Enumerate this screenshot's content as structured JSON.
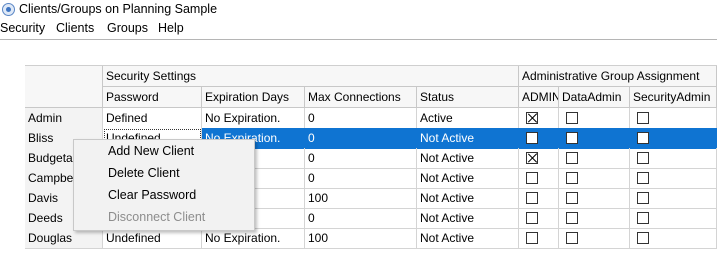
{
  "window": {
    "title": "Clients/Groups on Planning Sample"
  },
  "menu": {
    "items": [
      "Security",
      "Clients",
      "Groups",
      "Help"
    ]
  },
  "grid": {
    "group_headers": {
      "security": "Security Settings",
      "admin": "Administrative Group Assignment"
    },
    "columns": [
      "Password",
      "Expiration Days",
      "Max Connections",
      "Status",
      "ADMIN",
      "DataAdmin",
      "SecurityAdmin"
    ],
    "rows": [
      {
        "name": "Admin",
        "password": "Defined",
        "expiration": "No Expiration.",
        "max": "0",
        "status": "Active",
        "admin": true,
        "dataadmin": false,
        "securityadmin": false
      },
      {
        "name": "Bliss",
        "password": "Undefined",
        "expiration": "No Expiration.",
        "max": "0",
        "status": "Not Active",
        "admin": false,
        "dataadmin": false,
        "securityadmin": false
      },
      {
        "name": "Budgetac",
        "password": "",
        "expiration": "ion.",
        "max": "0",
        "status": "Not Active",
        "admin": true,
        "dataadmin": false,
        "securityadmin": false
      },
      {
        "name": "Campbell",
        "password": "",
        "expiration": "ion.",
        "max": "0",
        "status": "Not Active",
        "admin": false,
        "dataadmin": false,
        "securityadmin": false
      },
      {
        "name": "Davis",
        "password": "",
        "expiration": "ion.",
        "max": "100",
        "status": "Not Active",
        "admin": false,
        "dataadmin": false,
        "securityadmin": false
      },
      {
        "name": "Deeds",
        "password": "",
        "expiration": "ion.",
        "max": "0",
        "status": "Not Active",
        "admin": false,
        "dataadmin": false,
        "securityadmin": false
      },
      {
        "name": "Douglas",
        "password": "Undefined",
        "expiration": "No Expiration.",
        "max": "100",
        "status": "Not Active",
        "admin": false,
        "dataadmin": false,
        "securityadmin": false
      }
    ]
  },
  "context_menu": {
    "items": [
      {
        "label": "Add New Client",
        "enabled": true
      },
      {
        "label": "Delete Client",
        "enabled": true
      },
      {
        "label": "Clear Password",
        "enabled": true
      },
      {
        "label": "Disconnect Client",
        "enabled": false
      }
    ]
  },
  "colors": {
    "selection": "#0f74d2",
    "header_bg": "#f7f7f7",
    "menu_bg": "#f2f2f2",
    "disabled_text": "#8d8d8d"
  }
}
